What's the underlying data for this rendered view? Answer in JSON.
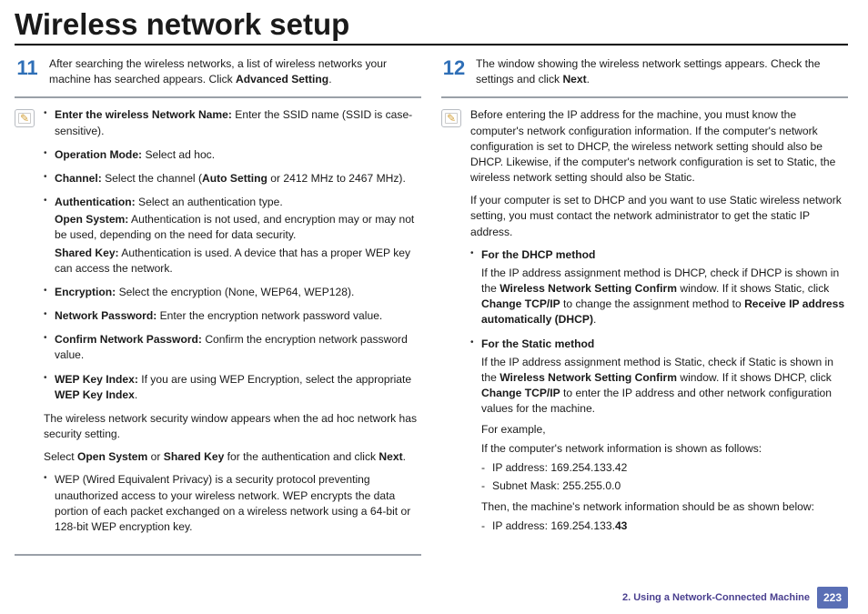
{
  "title": "Wireless network setup",
  "left": {
    "step_num": "11",
    "step_text_a": "After searching the wireless networks, a list of wireless networks your machine has searched appears. Click ",
    "step_text_b": "Advanced Setting",
    "step_text_c": ".",
    "note": {
      "bullets": [
        {
          "label": "Enter the wireless Network Name:",
          "text": " Enter the SSID name (SSID is case-sensitive)."
        },
        {
          "label": "Operation Mode:",
          "text": " Select ad hoc."
        },
        {
          "label": "Channel:",
          "text_pre": " Select the channel (",
          "bold": "Auto Setting",
          "text_post": " or 2412 MHz to 2467 MHz)."
        },
        {
          "label": "Authentication:",
          "text": " Select an authentication type.",
          "extra": [
            {
              "bold": "Open System:",
              "text": " Authentication is not used, and encryption may or may not be used, depending on the need for data security."
            },
            {
              "bold": "Shared Key:",
              "text": " Authentication is used. A device that has a proper WEP key can access the network."
            }
          ]
        },
        {
          "label": "Encryption:",
          "text": " Select the encryption (None, WEP64, WEP128)."
        },
        {
          "label": "Network Password:",
          "text": " Enter the encryption network password value."
        },
        {
          "label": "Confirm Network Password:",
          "text": " Confirm the encryption network password value."
        },
        {
          "label": "WEP Key Index:",
          "text_pre": " If you are using WEP Encryption, select the appropriate ",
          "bold2": "WEP Key Index",
          "text_post": "."
        }
      ],
      "para1": "The wireless network security window appears when the ad hoc network has security setting.",
      "para2_a": "Select ",
      "para2_b": "Open System",
      "para2_c": " or ",
      "para2_d": "Shared Key",
      "para2_e": " for the authentication and click ",
      "para2_f": "Next",
      "para2_g": ".",
      "wep_bullet": "WEP (Wired Equivalent Privacy) is a security protocol preventing unauthorized access to your wireless network. WEP encrypts the data portion of each packet exchanged on a wireless network using a 64-bit or 128-bit WEP encryption key."
    }
  },
  "right": {
    "step_num": "12",
    "step_text_a": "The window showing the wireless network settings appears. Check the settings and click ",
    "step_text_b": "Next",
    "step_text_c": ".",
    "note": {
      "intro": "Before entering the IP address for the machine, you must know the computer's network configuration information. If the computer's network configuration is set to DHCP, the wireless network setting should also be DHCP. Likewise, if the computer's network configuration is set to Static, the wireless network setting should also be Static.",
      "intro2": "If your computer is set to DHCP and you want to use Static wireless network setting, you must contact the network administrator to get the static IP address.",
      "dhcp_title": "For the DHCP method",
      "dhcp_text_a": "If the IP address assignment method is DHCP, check if DHCP is shown in the ",
      "dhcp_text_b": "Wireless Network Setting Confirm",
      "dhcp_text_c": " window. If it shows Static, click ",
      "dhcp_text_d": "Change TCP/IP",
      "dhcp_text_e": " to change the assignment method to ",
      "dhcp_text_f": "Receive IP address automatically (DHCP)",
      "dhcp_text_g": ".",
      "static_title": "For the Static method",
      "static_text_a": "If the IP address assignment method is Static, check if Static is shown in the ",
      "static_text_b": "Wireless Network Setting Confirm",
      "static_text_c": " window. If it shows DHCP, click ",
      "static_text_d": "Change TCP/IP",
      "static_text_e": " to enter the IP address and other network configuration values for the machine.",
      "example_label": "For example,",
      "example_intro": "If the computer's network information is shown as follows:",
      "example_ip": "IP address: 169.254.133.42",
      "example_mask": "Subnet Mask: 255.255.0.0",
      "example_then": "Then, the machine's network information should be as shown below:",
      "example_ip2_a": "IP address: 169.254.133.",
      "example_ip2_b": "43"
    }
  },
  "footer": {
    "chapter": "2.  Using a Network-Connected Machine",
    "page": "223"
  }
}
